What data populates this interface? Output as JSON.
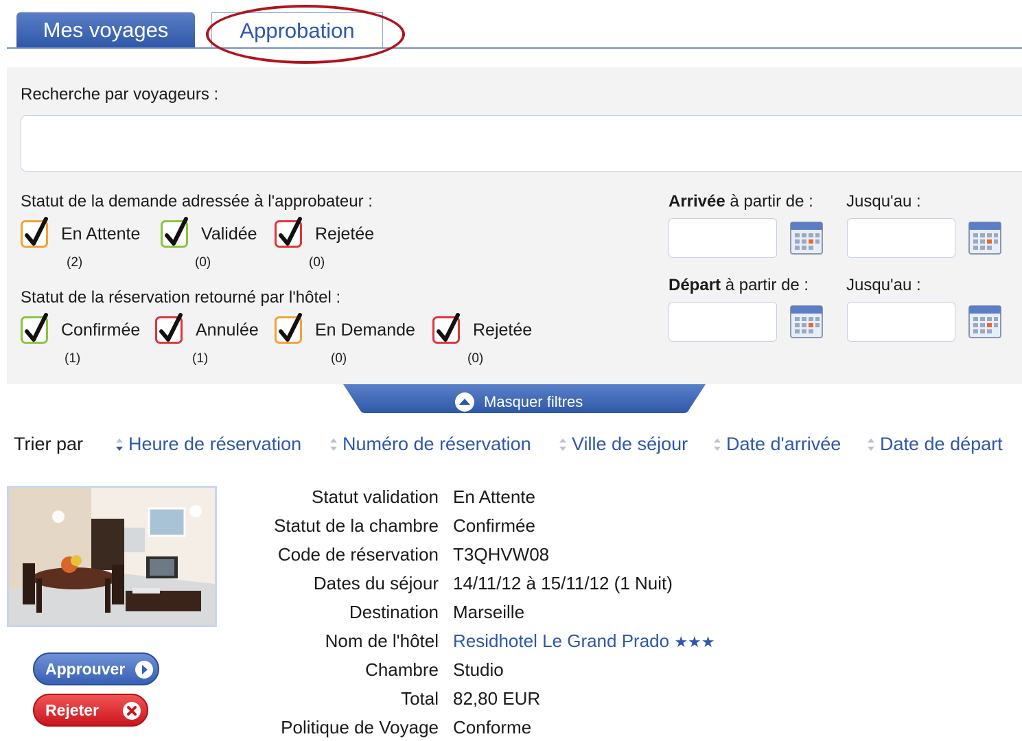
{
  "tabs": [
    {
      "label": "Mes voyages",
      "active": false
    },
    {
      "label": "Approbation",
      "active": true
    }
  ],
  "filters": {
    "search_label": "Recherche par voyageurs :",
    "search_value": "",
    "approval_status_label": "Statut de la demande adressée à l'approbateur :",
    "approval_status": [
      {
        "label": "En Attente",
        "count": "(2)",
        "checked": true,
        "color": "#f1a23b"
      },
      {
        "label": "Validée",
        "count": "(0)",
        "checked": true,
        "color": "#8bc43f"
      },
      {
        "label": "Rejetée",
        "count": "(0)",
        "checked": true,
        "color": "#e0343a"
      }
    ],
    "hotel_status_label": "Statut de la réservation retourné par l'hôtel :",
    "hotel_status": [
      {
        "label": "Confirmée",
        "count": "(1)",
        "checked": true,
        "color": "#8bc43f"
      },
      {
        "label": "Annulée",
        "count": "(1)",
        "checked": true,
        "color": "#e0343a"
      },
      {
        "label": "En Demande",
        "count": "(0)",
        "checked": true,
        "color": "#f1a23b"
      },
      {
        "label": "Rejetée",
        "count": "(0)",
        "checked": true,
        "color": "#e0343a"
      }
    ],
    "arrival_bold": "Arrivée",
    "arrival_rest": " à partir de :",
    "departure_bold": "Départ",
    "departure_rest": " à partir de :",
    "until_label": "Jusqu'au :",
    "hide_filters_label": "Masquer filtres"
  },
  "sort": {
    "label": "Trier par",
    "options": [
      "Heure de réservation",
      "Numéro de réservation",
      "Ville de séjour",
      "Date d'arrivée",
      "Date de départ"
    ],
    "active": "Heure de réservation"
  },
  "booking": {
    "rows": [
      {
        "label": "Statut validation",
        "value": "En Attente"
      },
      {
        "label": "Statut de la chambre",
        "value": "Confirmée"
      },
      {
        "label": "Code de réservation",
        "value": "T3QHVW08"
      },
      {
        "label": "Dates du séjour",
        "value": "14/11/12 à 15/11/12 (1 Nuit)"
      },
      {
        "label": "Destination",
        "value": "Marseille"
      },
      {
        "label": "Nom de l'hôtel",
        "value": "Residhotel Le Grand Prado",
        "stars": "★★★"
      },
      {
        "label": "Chambre",
        "value": "Studio"
      },
      {
        "label": "Total",
        "value": "82,80 EUR"
      },
      {
        "label": "Politique de Voyage",
        "value": "Conforme"
      }
    ],
    "approve_label": "Approuver",
    "reject_label": "Rejeter"
  },
  "colors": {
    "brand_blue": "#2e56ac",
    "highlight_ellipse": "#b1121b",
    "approve": "#3760b4",
    "reject": "#c9161e"
  }
}
